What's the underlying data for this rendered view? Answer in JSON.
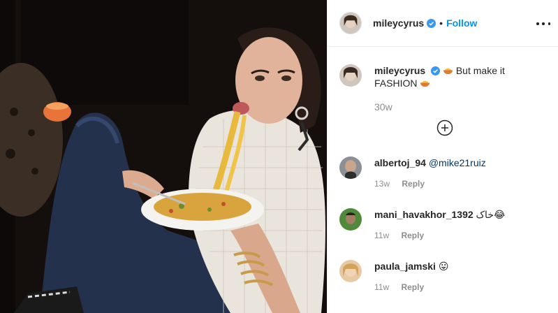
{
  "post": {
    "username": "mileycyrus",
    "separator": "•",
    "follow_label": "Follow"
  },
  "caption": {
    "username": "mileycyrus",
    "text_line1": "But make it",
    "text_line2": "FASHION",
    "age": "30w"
  },
  "comments": [
    {
      "username": "albertoj_94",
      "text": "@mike21ruiz",
      "age": "13w",
      "reply_label": "Reply"
    },
    {
      "username": "mani_havakhor_1392",
      "text": "خاک😂",
      "age": "11w",
      "reply_label": "Reply"
    },
    {
      "username": "paula_jamski",
      "text": "😛",
      "age": "11w",
      "reply_label": "Reply"
    }
  ],
  "icons": {
    "verified": "verified-badge-icon",
    "more": "more-options-icon",
    "load_more": "plus-circle-icon",
    "pasta_emoji": "spaghetti-emoji-icon"
  },
  "colors": {
    "link": "#0095f6",
    "mention": "#00376b",
    "muted": "#8e8e8e",
    "text": "#262626"
  }
}
